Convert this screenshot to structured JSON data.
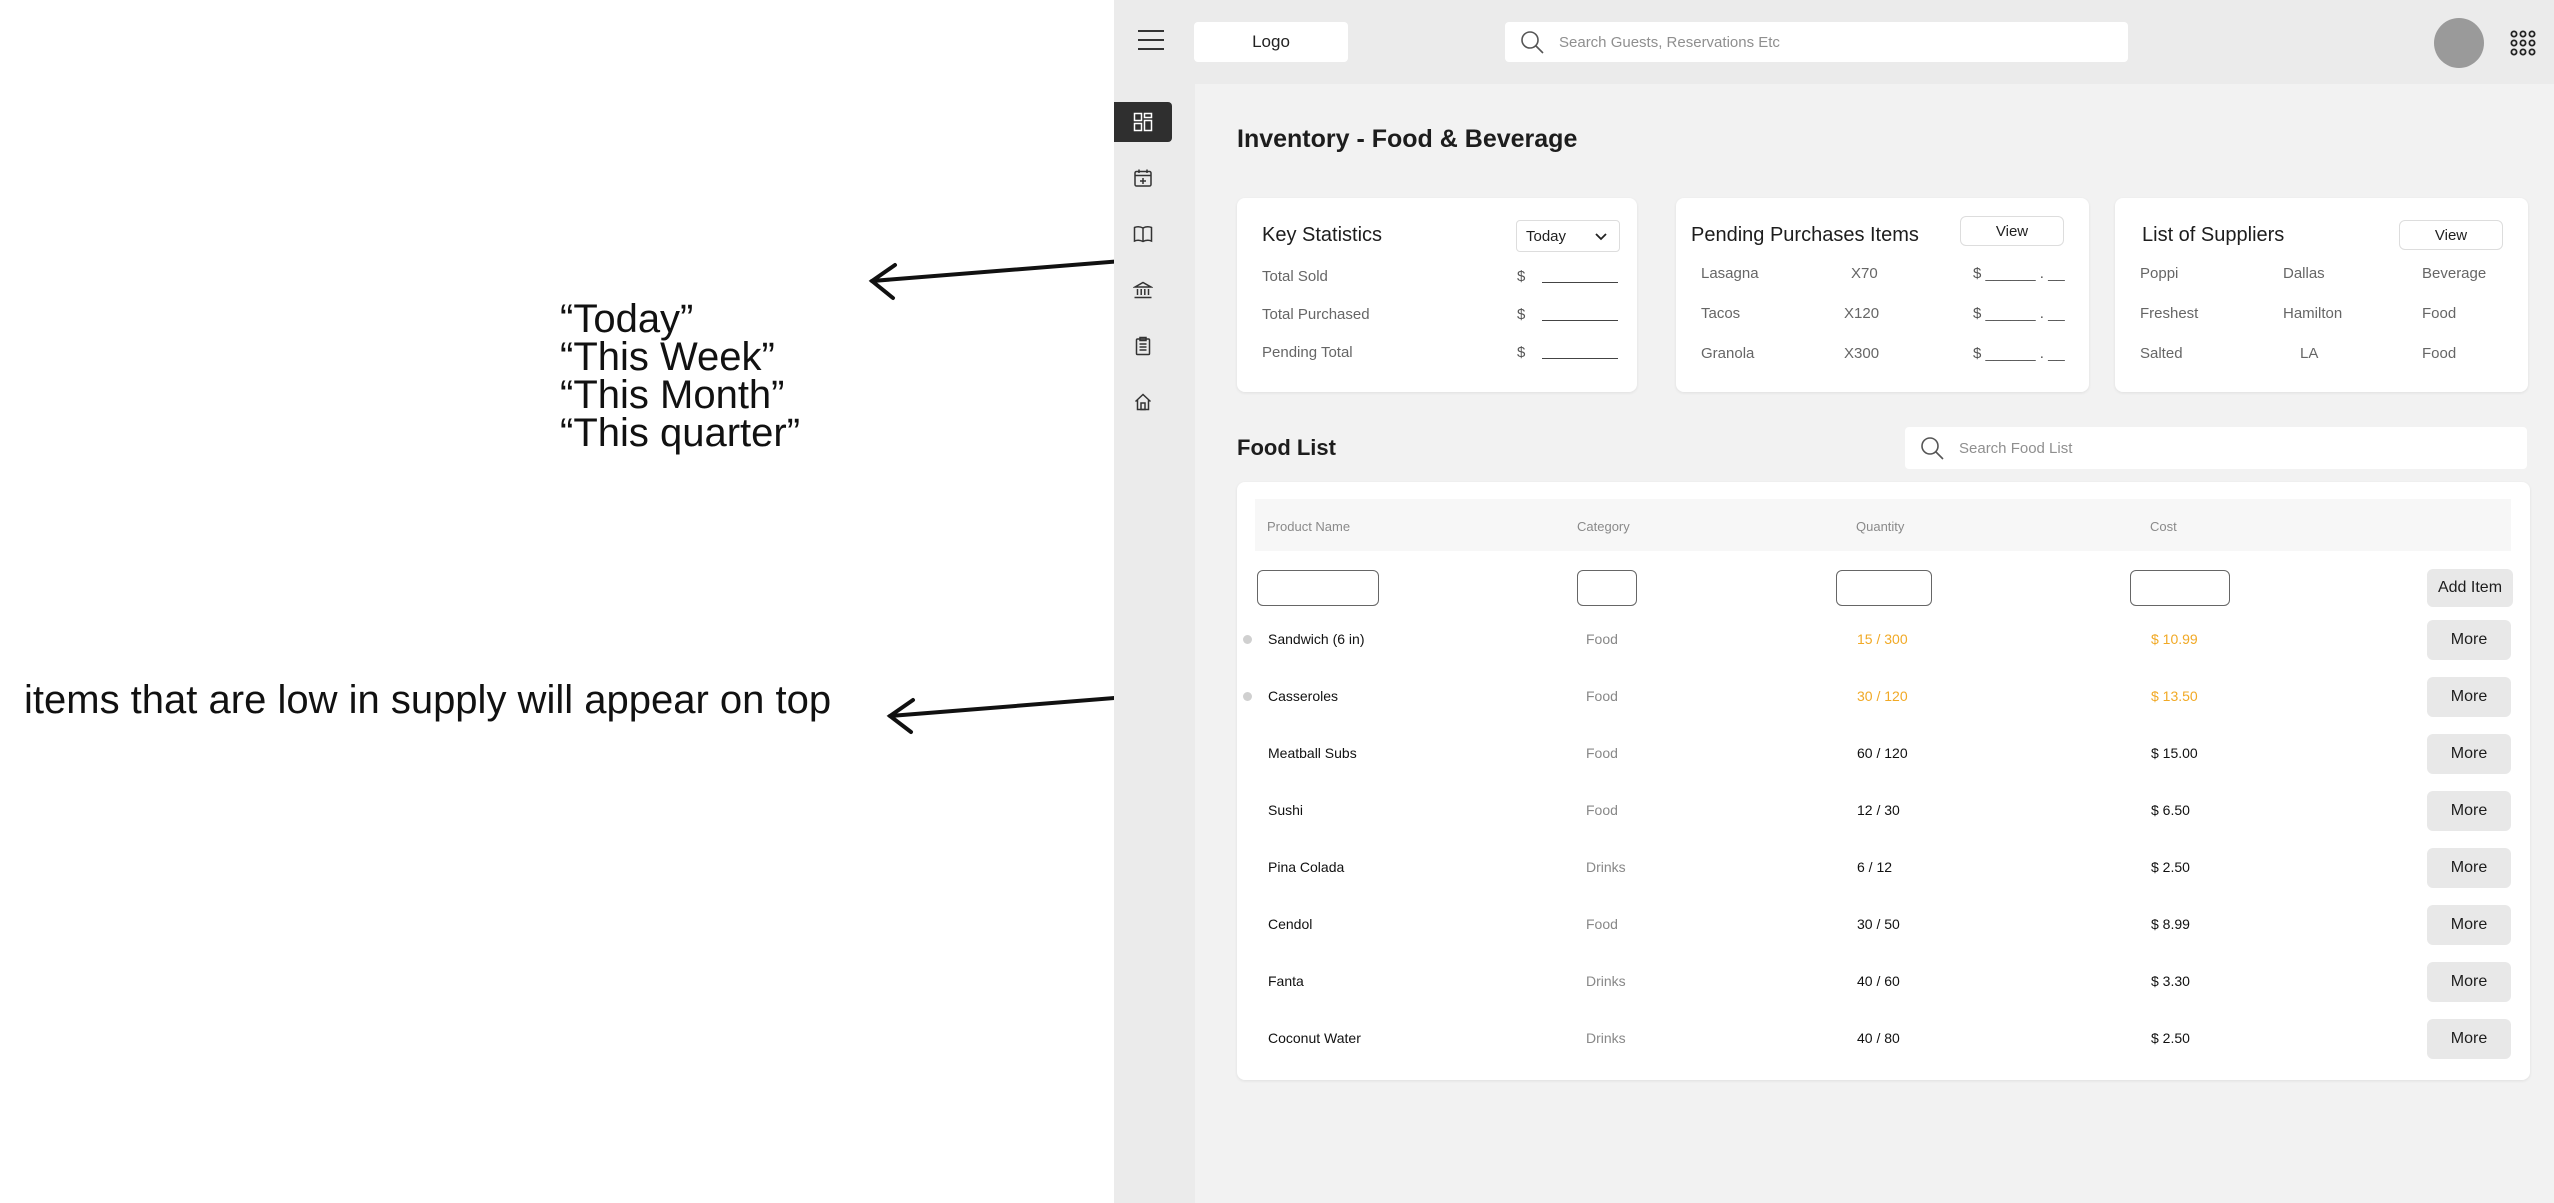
{
  "annotations": {
    "timeframe_options": [
      "“Today”",
      "“This Week”",
      "“This Month”",
      "“This quarter”"
    ],
    "low_supply_note": "items that are low in supply will appear on top"
  },
  "topbar": {
    "logo_label": "Logo",
    "search_placeholder": "Search Guests, Reservations Etc"
  },
  "sidebar": {
    "items": [
      {
        "icon": "dashboard-icon",
        "active": true
      },
      {
        "icon": "calendar-add-icon",
        "active": false
      },
      {
        "icon": "book-icon",
        "active": false
      },
      {
        "icon": "bank-icon",
        "active": false
      },
      {
        "icon": "clipboard-icon",
        "active": false
      },
      {
        "icon": "home-icon",
        "active": false
      }
    ]
  },
  "page": {
    "title": "Inventory - Food & Beverage"
  },
  "key_statistics": {
    "title": "Key Statistics",
    "timeframe_selected": "Today",
    "rows": [
      {
        "label": "Total Sold",
        "currency": "$"
      },
      {
        "label": "Total Purchased",
        "currency": "$"
      },
      {
        "label": "Pending Total",
        "currency": "$"
      }
    ]
  },
  "pending_purchases": {
    "title": "Pending Purchases Items",
    "view_label": "View",
    "items": [
      {
        "name": "Lasagna",
        "qty": "X70",
        "price": "$ ______ . __"
      },
      {
        "name": "Tacos",
        "qty": "X120",
        "price": "$ ______ . __"
      },
      {
        "name": "Granola",
        "qty": "X300",
        "price": "$ ______ . __"
      }
    ]
  },
  "suppliers": {
    "title": "List of Suppliers",
    "view_label": "View",
    "items": [
      {
        "name": "Poppi",
        "location": "Dallas",
        "type": "Beverage"
      },
      {
        "name": "Freshest",
        "location": "Hamilton",
        "type": "Food"
      },
      {
        "name": "Salted",
        "location": "LA",
        "type": "Food"
      }
    ]
  },
  "food_list": {
    "title": "Food List",
    "search_placeholder": "Search Food List",
    "columns": [
      "Product Name",
      "Category",
      "Quantity",
      "Cost"
    ],
    "add_item_label": "Add Item",
    "more_label": "More",
    "rows": [
      {
        "name": "Sandwich (6 in)",
        "category": "Food",
        "quantity": "15 / 300",
        "cost": "$ 10.99",
        "low": true
      },
      {
        "name": "Casseroles",
        "category": "Food",
        "quantity": "30 / 120",
        "cost": "$ 13.50",
        "low": true
      },
      {
        "name": "Meatball Subs",
        "category": "Food",
        "quantity": "60 / 120",
        "cost": "$ 15.00",
        "low": false
      },
      {
        "name": "Sushi",
        "category": "Food",
        "quantity": "12 / 30",
        "cost": "$ 6.50",
        "low": false
      },
      {
        "name": "Pina Colada",
        "category": "Drinks",
        "quantity": "6 / 12",
        "cost": "$ 2.50",
        "low": false
      },
      {
        "name": "Cendol",
        "category": "Food",
        "quantity": "30 / 50",
        "cost": "$ 8.99",
        "low": false
      },
      {
        "name": "Fanta",
        "category": "Drinks",
        "quantity": "40 / 60",
        "cost": "$ 3.30",
        "low": false
      },
      {
        "name": "Coconut Water",
        "category": "Drinks",
        "quantity": "40 / 80",
        "cost": "$ 2.50",
        "low": false
      }
    ]
  },
  "colors": {
    "low_stock": "#f1a925",
    "active_sidebar": "#2f2f2f"
  }
}
